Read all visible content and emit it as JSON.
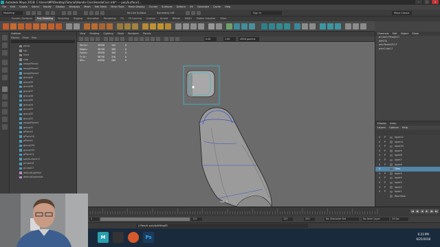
{
  "window": {
    "title": "Autodesk Maya 2018: C:\\Users\\MP\\Desktop\\Tutorial\\Honda Civic\\HondaCivic.mb* --- polySurface1…",
    "buttons": [
      "–",
      "□",
      "✕"
    ]
  },
  "menu_bar": {
    "items": [
      "File",
      "Edit",
      "Create",
      "Select",
      "Modify",
      "Display",
      "Windows",
      "Mesh",
      "Edit Mesh",
      "Mesh Tools",
      "Mesh Display",
      "Curves",
      "Surfaces",
      "Deform",
      "UV",
      "Generate",
      "Cache",
      "Help"
    ]
  },
  "status_line": {
    "mode": "Modeling",
    "live_surface": "No Live Surface",
    "symmetry": "Symmetry: Off",
    "signin": "Sign In",
    "workspace": "Maya Classic"
  },
  "shelf": {
    "tabs": [
      "Curves / Surfaces",
      "Poly Modeling",
      "Sculpting",
      "Rigging",
      "Animation",
      "Rendering",
      "FX",
      "FX Caching",
      "Custom",
      "Arnold",
      "Bifrost",
      "MASH",
      "Motion Graphics",
      "XGen"
    ],
    "active_tab": "Poly Modeling"
  },
  "outliner": {
    "title": "Outliner",
    "menus": [
      "Display",
      "Show",
      "Help"
    ],
    "items": [
      "persp",
      "top",
      "front",
      "side",
      "imagePlane1",
      "imagePlane2",
      "imagePlane3",
      "group40",
      "group39",
      "group38",
      "group37",
      "group36",
      "group35",
      "group34",
      "group33",
      "group32",
      "group31",
      "imagePlane4",
      "group41",
      "pPlane4",
      "pPlane16",
      "pPlane5",
      "group104",
      "group105",
      "pPlane11",
      "polySurface17",
      "pCube16",
      "pCube17",
      "defaultLightSet",
      "defaultObjectSet"
    ]
  },
  "panel": {
    "menus": [
      "View",
      "Shading",
      "Lighting",
      "Show",
      "Renderer",
      "Panels"
    ],
    "gamma": "sRGB gamma",
    "exposure": "0.00",
    "gamma_value": "1.00"
  },
  "hud": {
    "rows": [
      {
        "label": "Verts:",
        "a": "49330",
        "b": "142",
        "c": "0"
      },
      {
        "label": "Edges:",
        "a": "98748",
        "b": "300",
        "c": "0"
      },
      {
        "label": "Faces:",
        "a": "49530",
        "b": "160",
        "c": "0"
      },
      {
        "label": "Tris:",
        "a": "98736",
        "b": "316",
        "c": "0"
      },
      {
        "label": "UVs:",
        "a": "64936",
        "b": "200",
        "c": "0"
      }
    ],
    "camera_label": "side -X"
  },
  "channel_box": {
    "menus": [
      "Channels",
      "Edit",
      "Object",
      "Show"
    ],
    "lines": [
      "pCube17Shape17",
      "INPUTS",
      "polyTweakUV17",
      "polyCube17"
    ]
  },
  "layer_editor": {
    "tabs": [
      "Display",
      "Anim"
    ],
    "menus": [
      "Layers",
      "Options",
      "Help"
    ],
    "layers": [
      {
        "v": "V",
        "p": "P",
        "name": "layer12",
        "selected": false
      },
      {
        "v": "V",
        "p": "P",
        "name": "layer11",
        "selected": false
      },
      {
        "v": "V",
        "p": "P",
        "name": "layer10",
        "selected": false
      },
      {
        "v": "V",
        "p": "P",
        "name": "layer9",
        "selected": false
      },
      {
        "v": "V",
        "p": "P",
        "name": "layer8",
        "selected": false
      },
      {
        "v": "V",
        "p": "P",
        "name": "layer7",
        "selected": false
      },
      {
        "v": "V",
        "p": "P",
        "name": "layer6",
        "selected": false
      },
      {
        "v": "V",
        "p": "",
        "name": "Tires",
        "selected": true
      },
      {
        "v": "V",
        "p": "P",
        "name": "layer5",
        "selected": false
      },
      {
        "v": "V",
        "p": "P",
        "name": "layer4",
        "selected": false
      },
      {
        "v": "V",
        "p": "P",
        "name": "layer3",
        "selected": false
      },
      {
        "v": "V",
        "p": "P",
        "name": "layer2",
        "selected": false
      },
      {
        "v": "V",
        "p": "P",
        "name": "layer1",
        "selected": false
      },
      {
        "v": "",
        "p": "",
        "name": "RearView",
        "selected": false
      }
    ]
  },
  "time_slider": {
    "current_frame": "1",
    "playback": [
      "|◀",
      "◀|",
      "◀",
      "▶",
      "|▶",
      "▶|"
    ]
  },
  "range_slider": {
    "start": "1",
    "playback_start": "1",
    "playback_end": "120",
    "end": "120",
    "end2": "200",
    "char_set": "No Character Set",
    "anim_layer": "No Anim Layer",
    "fps": "24 fps"
  },
  "command_line": {
    "lang": "MEL",
    "result": "// Result: polySplitRing83"
  },
  "taskbar": {
    "time": "6:23 PM",
    "date": "6/25/2018"
  },
  "colors": {
    "viewport_bg": "#6b6b6b",
    "selection_highlight": "#5285a6",
    "wire_blue": "#3b4fbf",
    "model_gray": "#9b9b9b"
  }
}
